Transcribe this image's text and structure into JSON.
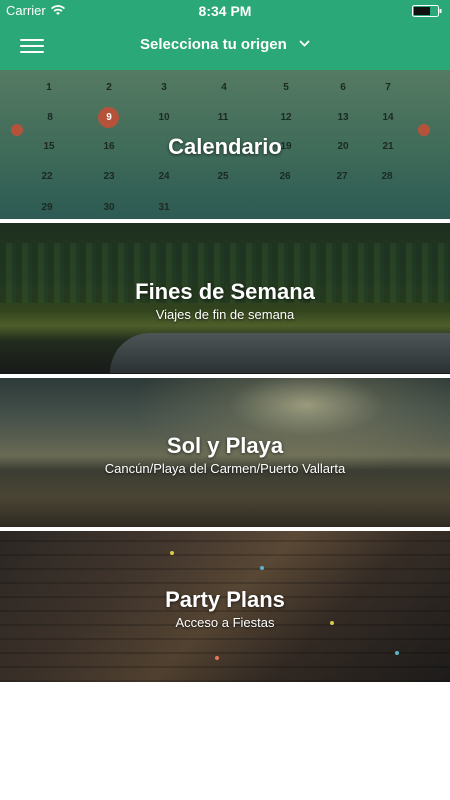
{
  "status_bar": {
    "carrier": "Carrier",
    "time": "8:34 PM"
  },
  "nav": {
    "title": "Selecciona tu origen",
    "menu_icon": "hamburger-menu-icon",
    "dropdown_icon": "chevron-down-icon"
  },
  "colors": {
    "brand_green": "#2aa877",
    "highlight": "#b5533a"
  },
  "cards": [
    {
      "title": "Calendario",
      "subtitle": ""
    },
    {
      "title": "Fines de Semana",
      "subtitle": "Viajes de fin de semana"
    },
    {
      "title": "Sol y Playa",
      "subtitle": "Cancún/Playa del Carmen/Puerto Vallarta"
    },
    {
      "title": "Party Plans",
      "subtitle": "Acceso a Fiestas"
    }
  ],
  "calendar_numbers": [
    "1",
    "2",
    "3",
    "4",
    "5",
    "6",
    "7",
    "8",
    "9",
    "10",
    "11",
    "12",
    "13",
    "14",
    "15",
    "16",
    "19",
    "20",
    "21",
    "22",
    "23",
    "24",
    "25",
    "26",
    "27",
    "28",
    "29",
    "30",
    "31"
  ]
}
